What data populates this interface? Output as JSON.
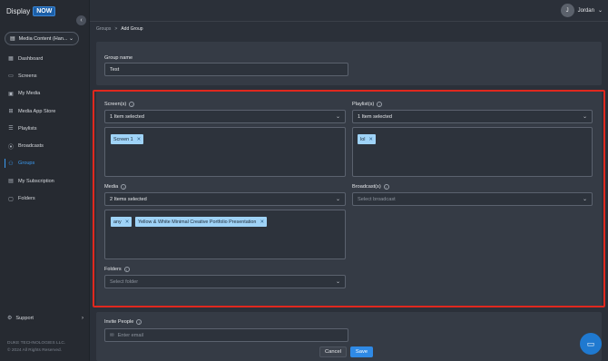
{
  "brand": {
    "name": "Display",
    "badge": "NOW"
  },
  "workspace": {
    "label": "Media Content (Han...",
    "icon": "folder-icon"
  },
  "nav": [
    {
      "label": "Dashboard",
      "icon": "dashboard-icon"
    },
    {
      "label": "Screens",
      "icon": "screens-icon"
    },
    {
      "label": "My Media",
      "icon": "media-icon"
    },
    {
      "label": "Media App Store",
      "icon": "app-store-icon"
    },
    {
      "label": "Playlists",
      "icon": "playlist-icon"
    },
    {
      "label": "Broadcasts",
      "icon": "broadcast-icon"
    },
    {
      "label": "Groups",
      "icon": "groups-icon",
      "active": true
    },
    {
      "label": "My Subscription",
      "icon": "subscription-icon"
    },
    {
      "label": "Folders",
      "icon": "folders-icon"
    }
  ],
  "support": {
    "label": "Support"
  },
  "copyright": {
    "line1": "DUKE TECHNOLOGIES LLC.",
    "line2": "© 2024 All Rights Reserved."
  },
  "user": {
    "initial": "J",
    "name": "Jordan"
  },
  "breadcrumb": {
    "parent": "Groups",
    "sep": ">",
    "current": "Add Group"
  },
  "group_name": {
    "label": "Group name",
    "value": "Test"
  },
  "screens": {
    "label": "Screen(s)",
    "selected": "1 Item selected",
    "tags": [
      "Screen 1"
    ]
  },
  "playlists": {
    "label": "Playlist(s)",
    "selected": "1 Item selected",
    "tags": [
      "lol"
    ]
  },
  "media": {
    "label": "Media",
    "selected": "2 Items selected",
    "tags": [
      "any",
      "Yellow & White Minimal Creative Portfolio Presentation"
    ]
  },
  "broadcasts": {
    "label": "Broadcast(s)",
    "placeholder": "Select broadcast"
  },
  "folders": {
    "label": "Folders",
    "placeholder": "Select folder"
  },
  "invite": {
    "label": "Invite People",
    "placeholder": "Enter email"
  },
  "actions": {
    "cancel": "Cancel",
    "save": "Save"
  },
  "colors": {
    "accent": "#2f8ae6",
    "highlight_frame": "#e0281e",
    "tag_bg": "#9fd3f7"
  }
}
